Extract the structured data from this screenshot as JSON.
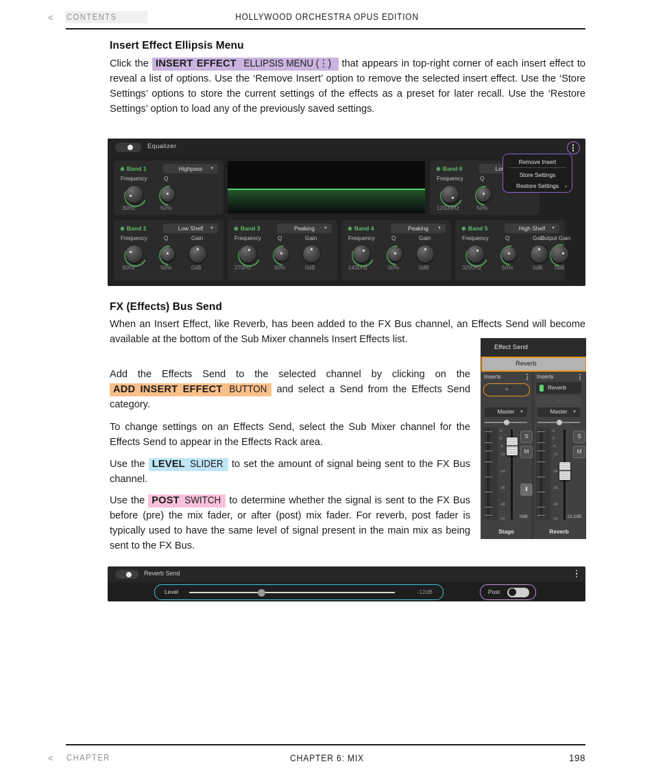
{
  "header": {
    "back_arrow": "<",
    "contents_label": "CONTENTS",
    "title": "HOLLYWOOD ORCHESTRA OPUS EDITION"
  },
  "footer": {
    "back_arrow": "<",
    "chapter_label": "CHAPTER",
    "title": "CHAPTER 6:  MIX",
    "page_number": "198"
  },
  "sections": {
    "ellipsis": {
      "heading": "Insert Effect Ellipsis Menu",
      "p1_a": "Click the",
      "hl_strong": "INSERT EFFECT",
      "hl_thin": "ELLIPSIS MENU (⋮)",
      "p1_b": "that appears in top-right corner of each insert effect to reveal a list of options. Use the ‘Remove Insert’ option to remove the selected insert effect. Use the ‘Store Settings’ options to store the current settings of the effects as a preset for later recall.  Use the ‘Restore Settings’ option to load any of the previously saved settings."
    },
    "fxbus": {
      "heading": "FX (Effects) Bus Send",
      "p1": "When an Insert Effect, like Reverb, has been added to the FX Bus channel, an Effects Send will become available at the bottom of the Sub Mixer channels Insert Effects list.",
      "p2_a": "Add the Effects Send to the selected channel by clicking on the",
      "p2_hl_strong": "ADD INSERT EFFECT",
      "p2_hl_thin": "BUTTON",
      "p2_b": "and select a Send from the Effects Send category.",
      "p3": "To change settings on an Effects Send, select the Sub Mixer channel for the Effects Send to appear in the Effects Rack area.",
      "p4_a": "Use the",
      "p4_hl_strong": "LEVEL",
      "p4_hl_thin": "SLIDER",
      "p4_b": "to set the amount of signal being sent to the FX Bus channel.",
      "p5_a": "Use the",
      "p5_hl_strong": "POST",
      "p5_hl_thin": "SWITCH",
      "p5_b": "to determine whether the signal is sent to the FX Bus before (pre) the mix fader, or after (post) mix fader. For reverb, post fader is typically used to have the same level of signal present in the main mix as being sent to the FX Bus."
    }
  },
  "equalizer_figure": {
    "title": "Equalizer",
    "power_on": true,
    "bands": [
      {
        "name": "Band 1",
        "type": "Highpass",
        "frequency": "30Hz",
        "q": "50%",
        "gain": null
      },
      {
        "name": "Band 2",
        "type": "Low Shelf",
        "frequency": "90Hz",
        "q": "50%",
        "gain": "0dB"
      },
      {
        "name": "Band 3",
        "type": "Peaking",
        "frequency": "270Hz",
        "q": "50%",
        "gain": "0dB"
      },
      {
        "name": "Band 4",
        "type": "Peaking",
        "frequency": "1400Hz",
        "q": "50%",
        "gain": "0dB"
      },
      {
        "name": "Band 5",
        "type": "High Shelf",
        "frequency": "3200Hz",
        "q": "50%",
        "gain": "0dB"
      },
      {
        "name": "Band 6",
        "type": "Lowpass",
        "frequency": "12000Hz",
        "q": "50%",
        "gain": null
      }
    ],
    "labels": {
      "frequency": "Frequency",
      "q": "Q",
      "gain": "Gain"
    },
    "output_gain_label": "Output Gain",
    "output_gain_value": "0dB",
    "context_menu": {
      "items": [
        "Remove Insert",
        "Store Settings",
        "Restore Settings"
      ],
      "submenu_arrow": "›"
    }
  },
  "mixer_figure": {
    "effect_send_header": "Effect Send",
    "effect_send_item": "Reverb",
    "inserts_label": "Inserts",
    "channels": [
      {
        "name": "Stage",
        "insert_slot": "+",
        "insert_slot_empty": "",
        "output": "Master",
        "solo": "S",
        "mute": "M",
        "download": "⬇",
        "db": "0dB"
      },
      {
        "name": "Reverb",
        "insert_slot": "Reverb",
        "insert_slot_empty": "+",
        "output": "Master",
        "solo": "S",
        "mute": "M",
        "db": "-13.1dB"
      }
    ],
    "meter_scale": [
      "6",
      "0",
      "-6",
      "-12",
      "-24",
      "-36",
      "-48",
      "-60"
    ]
  },
  "reverb_send_figure": {
    "title": "Reverb Send",
    "level_label": "Level",
    "level_value": "-12dB",
    "post_label": "Post",
    "post_on": true
  },
  "colors": {
    "highlight_purple": "#cbb4e0",
    "highlight_orange": "#fbc08a",
    "highlight_blue": "#bfe5f7",
    "highlight_pink": "#f9c0dc",
    "accent_green": "#5fbb6a",
    "accent_violet": "#8f63cf",
    "accent_orange": "#e8951f",
    "accent_cyan": "#3fc4e0"
  }
}
